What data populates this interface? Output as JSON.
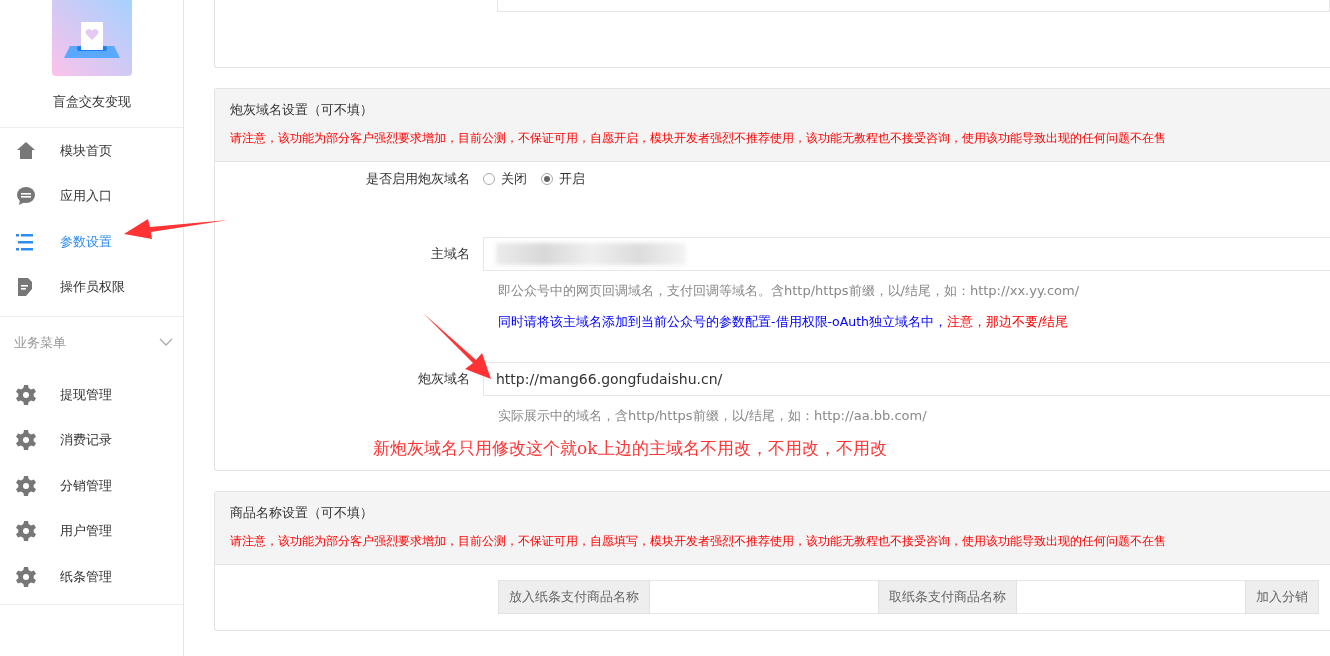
{
  "sidebar": {
    "app_name": "盲盒交友变现",
    "items": [
      {
        "label": "模块首页",
        "kind": "home",
        "selected": false
      },
      {
        "label": "应用入口",
        "kind": "chat",
        "selected": false
      },
      {
        "label": "参数设置",
        "kind": "list",
        "selected": true
      },
      {
        "label": "操作员权限",
        "kind": "doc",
        "selected": false
      }
    ],
    "section": {
      "title": "业务菜单",
      "expanded": true,
      "items": [
        {
          "label": "提现管理",
          "kind": "gear",
          "selected": false
        },
        {
          "label": "消费记录",
          "kind": "gear",
          "selected": false
        },
        {
          "label": "分销管理",
          "kind": "gear",
          "selected": false
        },
        {
          "label": "用户管理",
          "kind": "gear",
          "selected": false
        },
        {
          "label": "纸条管理",
          "kind": "gear",
          "selected": false
        }
      ]
    }
  },
  "cannon_section": {
    "title": "炮灰域名设置（可不填）",
    "warning": "请注意，该功能为部分客户强烈要求增加，目前公测，不保证可用，自愿开启，模块开发者强烈不推荐使用，该功能无教程也不接受咨询，使用该功能导致出现的任何问题不在售",
    "toggle": {
      "label": "是否启用炮灰域名",
      "options": [
        {
          "label": "关闭",
          "selected": false
        },
        {
          "label": "开启",
          "selected": true
        }
      ]
    },
    "main_domain": {
      "label": "主域名",
      "help": "即公众号中的网页回调域名，支付回调等域名。含http/https前缀，以/结尾，如：http://xx.yy.com/",
      "note": "同时请将该主域名添加到当前公众号的参数配置-借用权限-oAuth独立域名中，",
      "note_warning": "注意，那边不要/结尾"
    },
    "cannon_domain": {
      "label": "炮灰域名",
      "value": "http://mang66.gongfudaishu.cn/",
      "help": "实际展示中的域名，含http/https前缀，以/结尾，如：http://aa.bb.com/"
    },
    "annotation": "新炮灰域名只用修改这个就ok上边的主域名不用改，不用改，不用改"
  },
  "product_section": {
    "title": "商品名称设置（可不填）",
    "warning": "请注意，该功能为部分客户强烈要求增加，目前公测，不保证可用，自愿填写，模块开发者强烈不推荐使用，该功能无教程也不接受咨询，使用该功能导致出现的任何问题不在售",
    "fields": [
      {
        "label": "放入纸条支付商品名称"
      },
      {
        "label": "取纸条支付商品名称"
      },
      {
        "label": "加入分销"
      }
    ]
  }
}
